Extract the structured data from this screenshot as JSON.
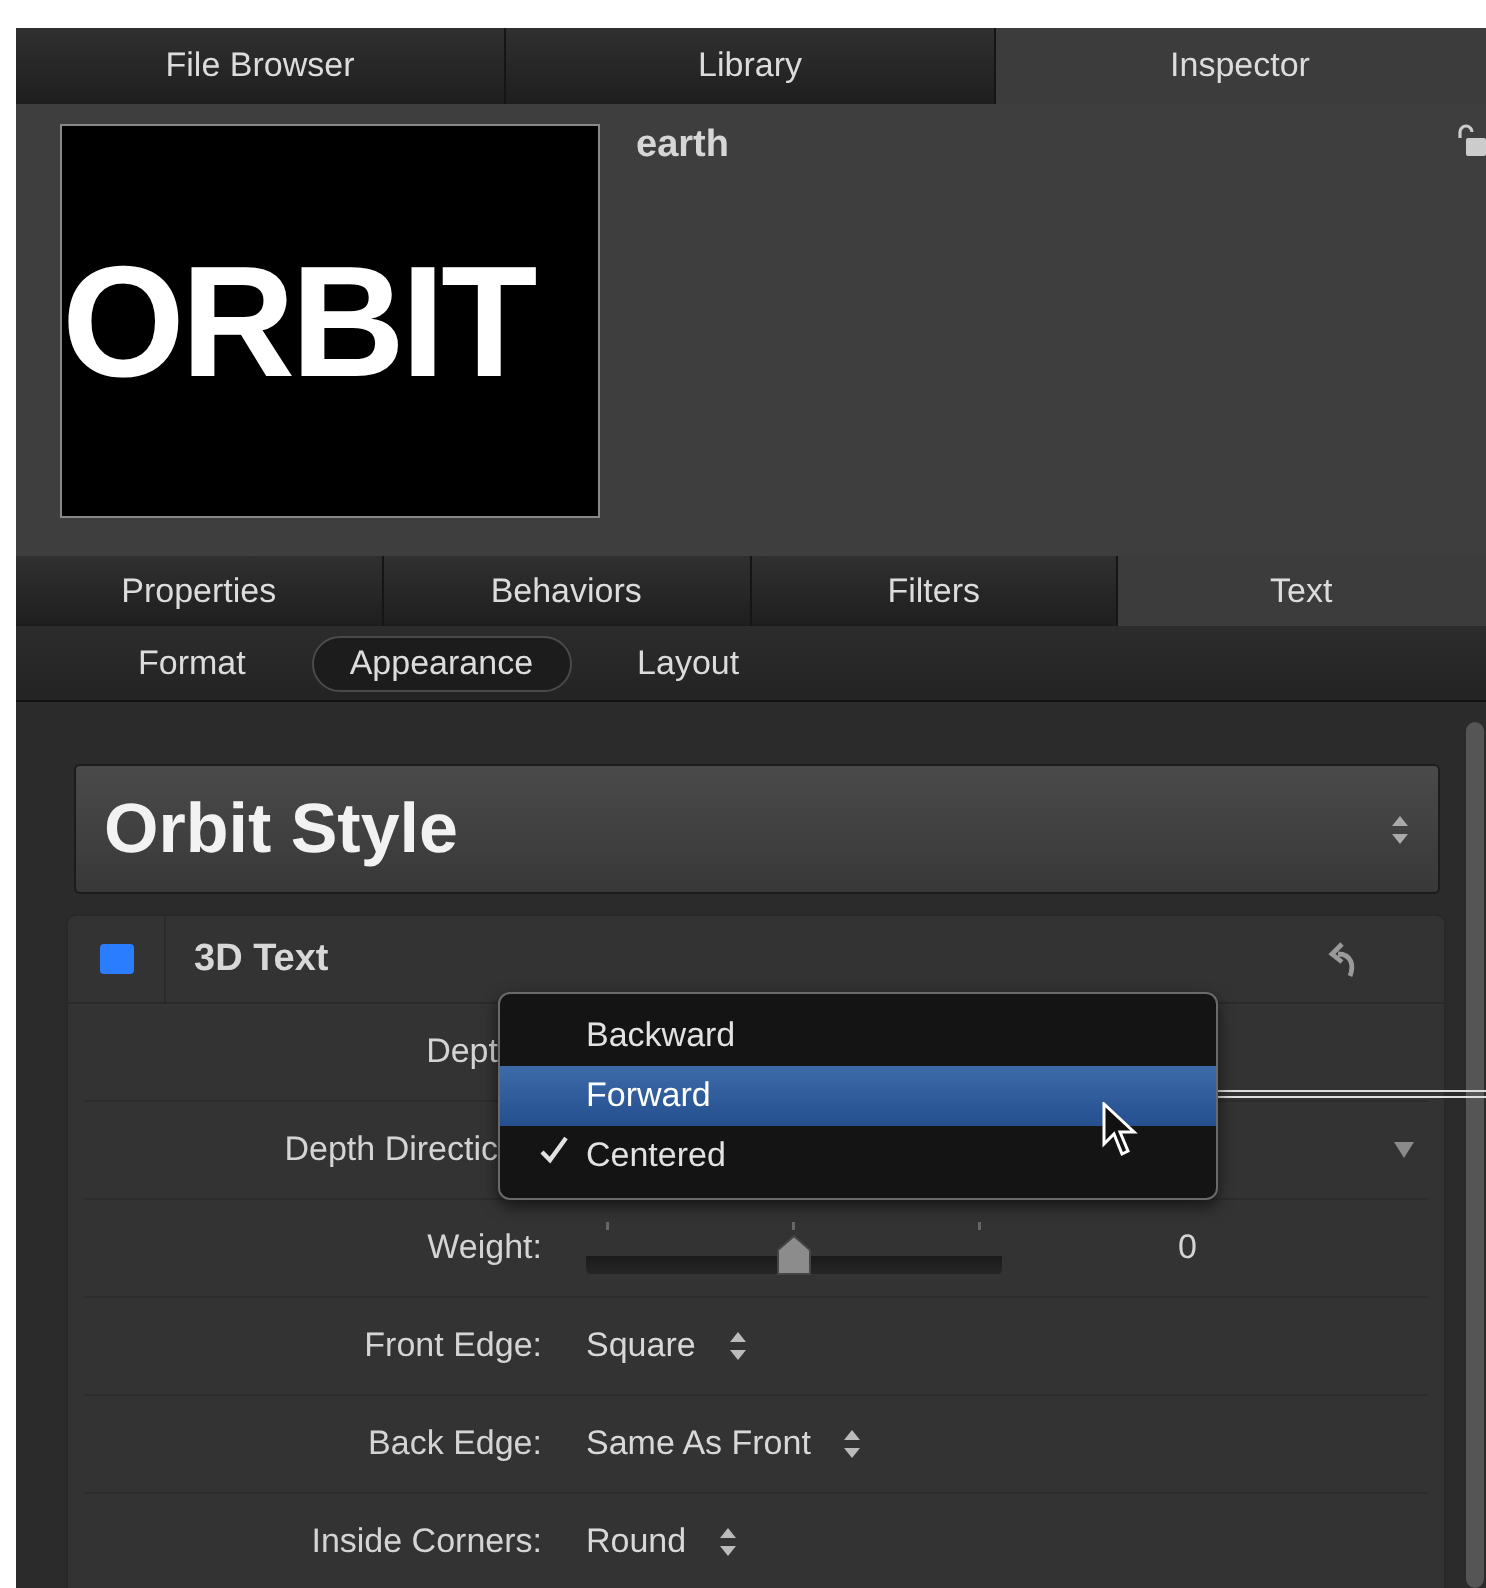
{
  "top_tabs": [
    {
      "label": "File Browser",
      "selected": false
    },
    {
      "label": "Library",
      "selected": false
    },
    {
      "label": "Inspector",
      "selected": true
    }
  ],
  "object": {
    "name": "earth",
    "thumbnail_text": "ORBIT"
  },
  "inspector_tabs": [
    {
      "label": "Properties",
      "selected": false
    },
    {
      "label": "Behaviors",
      "selected": false
    },
    {
      "label": "Filters",
      "selected": false
    },
    {
      "label": "Text",
      "selected": true
    }
  ],
  "sub_tabs": [
    {
      "label": "Format",
      "selected": false
    },
    {
      "label": "Appearance",
      "selected": true
    },
    {
      "label": "Layout",
      "selected": false
    }
  ],
  "style_preset": "Orbit Style",
  "section": {
    "title": "3D Text",
    "enabled": true,
    "rows": [
      {
        "label": "Dept",
        "kind": "covered"
      },
      {
        "label": "Depth Directic",
        "kind": "popup"
      },
      {
        "label": "Weight:",
        "kind": "slider",
        "level": 0.5,
        "value": "0"
      },
      {
        "label": "Front Edge:",
        "kind": "stepper",
        "value": "Square"
      },
      {
        "label": "Back Edge:",
        "kind": "stepper",
        "value": "Same As Front"
      },
      {
        "label": "Inside Corners:",
        "kind": "stepper",
        "value": "Round"
      }
    ]
  },
  "menu": {
    "items": [
      {
        "label": "Backward",
        "selected": false,
        "checked": false
      },
      {
        "label": "Forward",
        "selected": true,
        "checked": false
      },
      {
        "label": "Centered",
        "selected": false,
        "checked": true
      }
    ]
  }
}
